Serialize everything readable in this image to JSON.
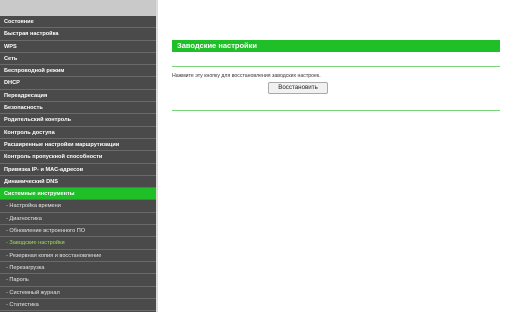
{
  "sidebar": {
    "items": [
      {
        "label": "Состояние"
      },
      {
        "label": "Быстрая настройка"
      },
      {
        "label": "WPS"
      },
      {
        "label": "Сеть"
      },
      {
        "label": "Беспроводной режим"
      },
      {
        "label": "DHCP"
      },
      {
        "label": "Переадресация"
      },
      {
        "label": "Безопасность"
      },
      {
        "label": "Родительский контроль"
      },
      {
        "label": "Контроль доступа"
      },
      {
        "label": "Расширенные настройки маршрутизации"
      },
      {
        "label": "Контроль пропускной способности"
      },
      {
        "label": "Привязка IP- и MAC-адресов"
      },
      {
        "label": "Динамический DNS"
      },
      {
        "label": "Системные инструменты"
      },
      {
        "label": "- Настройка времени"
      },
      {
        "label": "- Диагностика"
      },
      {
        "label": "- Обновление встроенного ПО"
      },
      {
        "label": "- Заводские настройки"
      },
      {
        "label": "- Резервная копия и восстановление"
      },
      {
        "label": "- Перезагрузка"
      },
      {
        "label": "- Пароль"
      },
      {
        "label": "- Системный журнал"
      },
      {
        "label": "- Статистика"
      }
    ]
  },
  "main": {
    "title": "Заводские настройки",
    "instruction": "Нажмите эту кнопку для восстановления заводских настроек.",
    "restore_button": "Восстановить"
  },
  "colors": {
    "accent": "#1fbf28",
    "sidebar_bg": "#4a4a4a",
    "selected_sub": "#9adf55"
  }
}
